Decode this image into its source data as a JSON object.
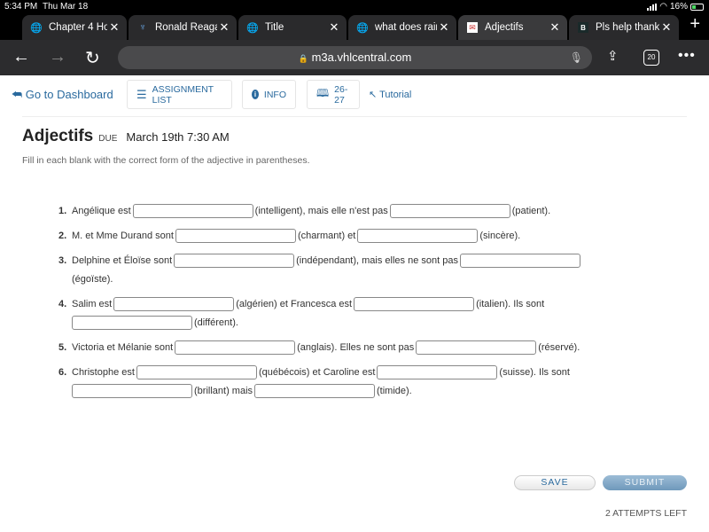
{
  "status_bar": {
    "time": "5:34 PM",
    "date": "Thu Mar 18",
    "battery": "16%"
  },
  "tabs": [
    {
      "title": "Chapter 4 Hom",
      "icon": "globe-icon"
    },
    {
      "title": "Ronald Reagan",
      "icon": "site-icon"
    },
    {
      "title": "Title",
      "icon": "globe-icon"
    },
    {
      "title": "what does rain",
      "icon": "globe-icon"
    },
    {
      "title": "Adjectifs",
      "icon": "vhl-icon",
      "active": true
    },
    {
      "title": "Pls help thank y",
      "icon": "brainly-icon"
    }
  ],
  "address_bar": {
    "url": "m3a.vhlcentral.com",
    "tab_count": "20"
  },
  "nav": {
    "dashboard": "Go to Dashboard",
    "assignment_list": "ASSIGNMENT LIST",
    "info": "INFO",
    "pages": "26-27",
    "tutorial": "Tutorial"
  },
  "assignment": {
    "title": "Adjectifs",
    "due_label": "DUE",
    "due_date": "March 19th 7:30 AM",
    "instructions": "Fill in each blank with the correct form of the adjective in parentheses."
  },
  "questions": [
    {
      "num": "1.",
      "parts": [
        "Angélique est",
        "(intelligent), mais elle n'est pas",
        "(patient)."
      ]
    },
    {
      "num": "2.",
      "parts": [
        "M. et Mme Durand sont",
        "(charmant) et",
        "(sincère)."
      ]
    },
    {
      "num": "3.",
      "parts": [
        "Delphine et Éloïse sont",
        "(indépendant), mais elles ne sont pas",
        "(égoïste)."
      ]
    },
    {
      "num": "4.",
      "parts": [
        "Salim est",
        "(algérien) et Francesca est",
        "(italien). Ils sont",
        "(différent)."
      ]
    },
    {
      "num": "5.",
      "parts": [
        "Victoria et Mélanie sont",
        "(anglais). Elles ne sont pas",
        "(réservé)."
      ]
    },
    {
      "num": "6.",
      "parts": [
        "Christophe est",
        "(québécois) et Caroline est",
        "(suisse). Ils sont",
        "(brillant) mais",
        "(timide)."
      ]
    }
  ],
  "actions": {
    "save": "SAVE",
    "submit": "SUBMIT",
    "attempts": "2 ATTEMPTS LEFT"
  }
}
